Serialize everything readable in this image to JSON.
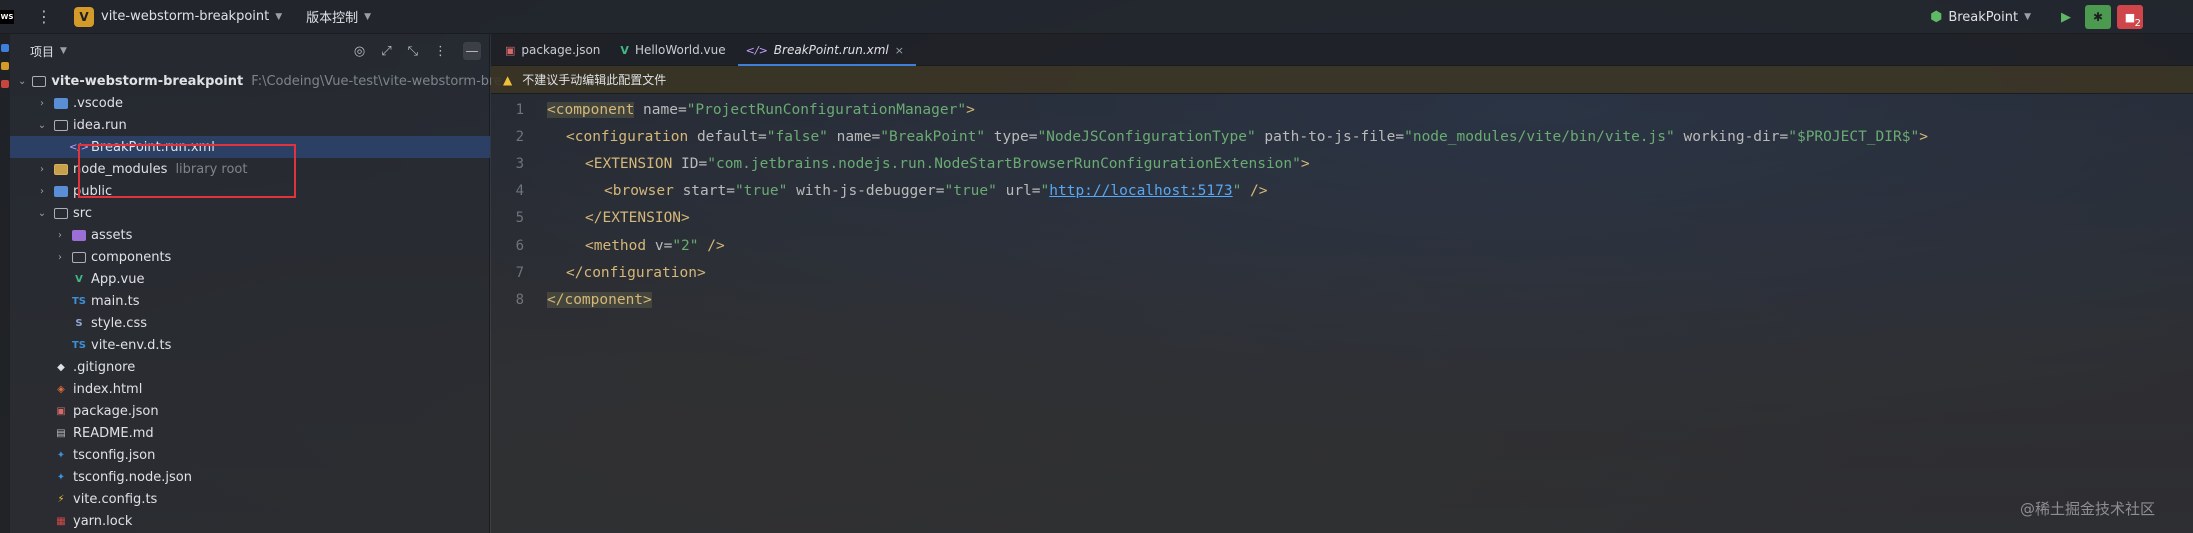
{
  "app": {
    "logo_text": "WS",
    "project_letter": "V",
    "project_name": "vite-webstorm-breakpoint",
    "vcs_label": "版本控制",
    "run_config": "BreakPoint",
    "stop_badge": "2"
  },
  "project_panel": {
    "title": "项目",
    "tree": [
      {
        "indent": 0,
        "arrow": "open",
        "icon": "folder-outline",
        "label": "vite-webstorm-breakpoint",
        "hint": "F:\\Codeing\\Vue-test\\vite-webstorm-bre",
        "bold": true
      },
      {
        "indent": 1,
        "arrow": "closed",
        "icon": "folder-blue",
        "label": ".vscode"
      },
      {
        "indent": 1,
        "arrow": "open",
        "icon": "folder-outline",
        "label": "idea.run"
      },
      {
        "indent": 2,
        "arrow": "",
        "icon": "xml",
        "label": "BreakPoint.run.xml",
        "selected": true
      },
      {
        "indent": 1,
        "arrow": "closed",
        "icon": "folder-orange",
        "label": "node_modules",
        "hint": "library root"
      },
      {
        "indent": 1,
        "arrow": "closed",
        "icon": "folder-blue",
        "label": "public"
      },
      {
        "indent": 1,
        "arrow": "open",
        "icon": "folder-outline",
        "label": "src"
      },
      {
        "indent": 2,
        "arrow": "closed",
        "icon": "folder-purple",
        "label": "assets"
      },
      {
        "indent": 2,
        "arrow": "closed",
        "icon": "folder-outline",
        "label": "components"
      },
      {
        "indent": 2,
        "arrow": "",
        "icon": "vue",
        "label": "App.vue"
      },
      {
        "indent": 2,
        "arrow": "",
        "icon": "ts",
        "label": "main.ts"
      },
      {
        "indent": 2,
        "arrow": "",
        "icon": "css",
        "label": "style.css"
      },
      {
        "indent": 2,
        "arrow": "",
        "icon": "ts",
        "label": "vite-env.d.ts"
      },
      {
        "indent": 1,
        "arrow": "",
        "icon": "git",
        "label": ".gitignore"
      },
      {
        "indent": 1,
        "arrow": "",
        "icon": "html",
        "label": "index.html"
      },
      {
        "indent": 1,
        "arrow": "",
        "icon": "json",
        "label": "package.json"
      },
      {
        "indent": 1,
        "arrow": "",
        "icon": "md",
        "label": "README.md"
      },
      {
        "indent": 1,
        "arrow": "",
        "icon": "tsc",
        "label": "tsconfig.json"
      },
      {
        "indent": 1,
        "arrow": "",
        "icon": "tsc",
        "label": "tsconfig.node.json"
      },
      {
        "indent": 1,
        "arrow": "",
        "icon": "vite",
        "label": "vite.config.ts"
      },
      {
        "indent": 1,
        "arrow": "",
        "icon": "yarn",
        "label": "yarn.lock"
      }
    ]
  },
  "editor": {
    "tabs": [
      {
        "icon": "json",
        "label": "package.json",
        "active": false
      },
      {
        "icon": "vue",
        "label": "HelloWorld.vue",
        "active": false
      },
      {
        "icon": "xml",
        "label": "BreakPoint.run.xml",
        "active": true
      }
    ],
    "banner": "不建议手动编辑此配置文件",
    "code_lines": [
      {
        "n": "1",
        "indent": 0,
        "tokens": [
          [
            "tag",
            "<component"
          ],
          [
            "attr",
            " name="
          ],
          [
            "val",
            "\"ProjectRunConfigurationManager\""
          ],
          [
            "tag",
            ">"
          ]
        ],
        "match": true
      },
      {
        "n": "2",
        "indent": 1,
        "tokens": [
          [
            "tag",
            "<configuration"
          ],
          [
            "attr",
            " default="
          ],
          [
            "val",
            "\"false\""
          ],
          [
            "attr",
            " name="
          ],
          [
            "val",
            "\"BreakPoint\""
          ],
          [
            "attr",
            " type="
          ],
          [
            "val",
            "\"NodeJSConfigurationType\""
          ],
          [
            "attr",
            " path-to-js-file="
          ],
          [
            "val",
            "\"node_modules/vite/bin/vite.js\""
          ],
          [
            "attr",
            " working-dir="
          ],
          [
            "val",
            "\"$PROJECT_DIR$\""
          ],
          [
            "tag",
            ">"
          ]
        ]
      },
      {
        "n": "3",
        "indent": 2,
        "tokens": [
          [
            "tag",
            "<EXTENSION"
          ],
          [
            "attr",
            " ID="
          ],
          [
            "val",
            "\"com.jetbrains.nodejs.run.NodeStartBrowserRunConfigurationExtension\""
          ],
          [
            "tag",
            ">"
          ]
        ]
      },
      {
        "n": "4",
        "indent": 3,
        "tokens": [
          [
            "tag",
            "<browser"
          ],
          [
            "attr",
            " start="
          ],
          [
            "val",
            "\"true\""
          ],
          [
            "attr",
            " with-js-debugger="
          ],
          [
            "val",
            "\"true\""
          ],
          [
            "attr",
            " url="
          ],
          [
            "val",
            "\""
          ],
          [
            "url",
            "http://localhost:5173"
          ],
          [
            "val",
            "\""
          ],
          [
            "tag",
            " />"
          ]
        ]
      },
      {
        "n": "5",
        "indent": 2,
        "tokens": [
          [
            "tag",
            "</EXTENSION>"
          ]
        ]
      },
      {
        "n": "6",
        "indent": 2,
        "tokens": [
          [
            "tag",
            "<method"
          ],
          [
            "attr",
            " v="
          ],
          [
            "val",
            "\"2\""
          ],
          [
            "tag",
            " />"
          ]
        ]
      },
      {
        "n": "7",
        "indent": 1,
        "tokens": [
          [
            "tag",
            "</configuration>"
          ]
        ]
      },
      {
        "n": "8",
        "indent": 0,
        "tokens": [
          [
            "tag",
            "</component>"
          ]
        ],
        "match": true
      }
    ]
  },
  "watermark": "@稀土掘金技术社区"
}
